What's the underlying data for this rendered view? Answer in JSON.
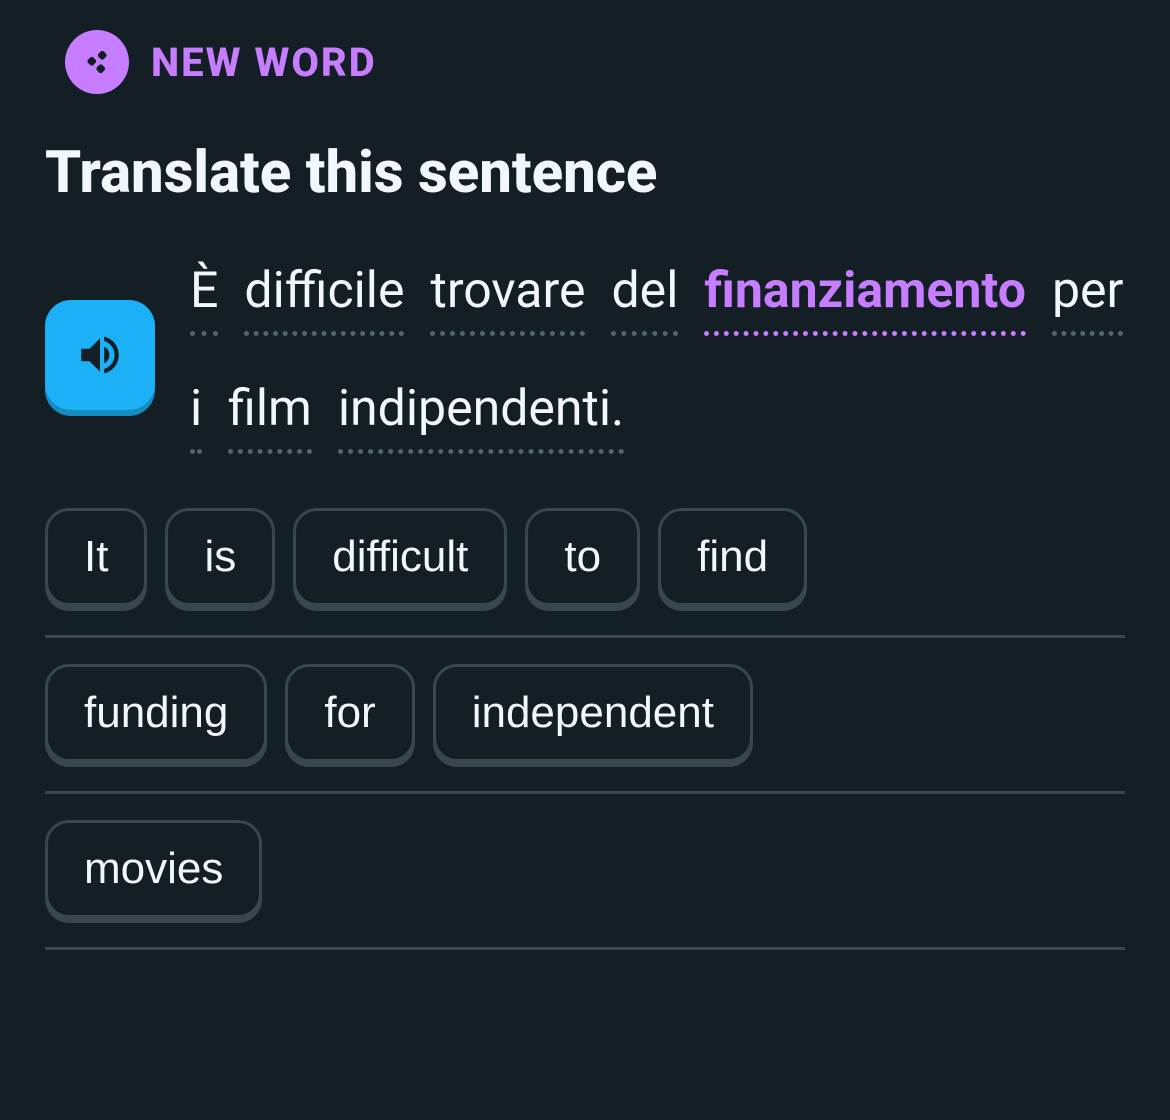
{
  "badge": {
    "label": "NEW WORD"
  },
  "instruction": "Translate this sentence",
  "sentence": {
    "words": [
      {
        "text": "È",
        "highlight": false
      },
      {
        "text": "difficile",
        "highlight": false
      },
      {
        "text": "trovare",
        "highlight": false
      },
      {
        "text": "del",
        "highlight": false
      },
      {
        "text": "finanziamento",
        "highlight": true
      },
      {
        "text": "per",
        "highlight": false
      },
      {
        "text": "i",
        "highlight": false
      },
      {
        "text": "film",
        "highlight": false
      },
      {
        "text": "indipendenti.",
        "highlight": false
      }
    ]
  },
  "answer_rows": [
    [
      "It",
      "is",
      "difficult",
      "to",
      "find"
    ],
    [
      "funding",
      "for",
      "independent"
    ],
    [
      "movies"
    ]
  ]
}
